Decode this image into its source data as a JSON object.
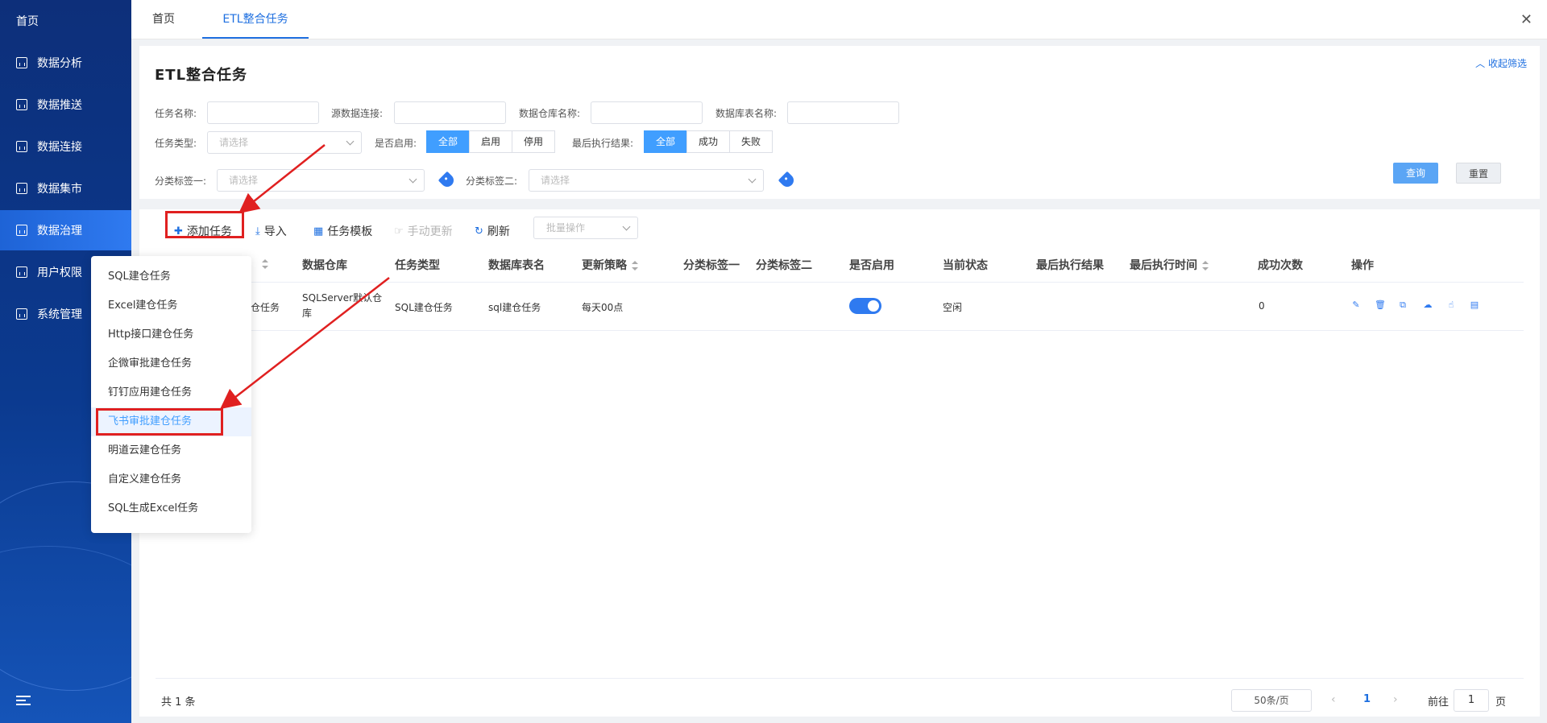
{
  "sidebar": {
    "home": "首页",
    "items": [
      {
        "label": "数据分析",
        "icon": "chart-icon"
      },
      {
        "label": "数据推送",
        "icon": "upload-chart-icon"
      },
      {
        "label": "数据连接",
        "icon": "connection-icon"
      },
      {
        "label": "数据集市",
        "icon": "monitor-icon"
      },
      {
        "label": "数据治理",
        "icon": "layers-icon",
        "active": true
      },
      {
        "label": "用户权限",
        "icon": "users-icon"
      },
      {
        "label": "系统管理",
        "icon": "system-icon"
      }
    ]
  },
  "tabs": {
    "home": "首页",
    "active": "ETL整合任务"
  },
  "filter": {
    "title": "ETL整合任务",
    "collapse": "收起筛选",
    "task_name_label": "任务名称:",
    "source_conn_label": "源数据连接:",
    "warehouse_name_label": "数据仓库名称:",
    "table_name_label": "数据库表名称:",
    "task_type_label": "任务类型:",
    "task_type_placeholder": "请选择",
    "enabled_label": "是否启用:",
    "enabled_options": [
      "全部",
      "启用",
      "停用"
    ],
    "last_result_label": "最后执行结果:",
    "last_result_options": [
      "全部",
      "成功",
      "失败"
    ],
    "tag1_label": "分类标签一:",
    "tag1_placeholder": "请选择",
    "tag2_label": "分类标签二:",
    "tag2_placeholder": "请选择",
    "query": "查询",
    "reset": "重置"
  },
  "toolbar": {
    "add": "添加任务",
    "import": "导入",
    "template": "任务模板",
    "manual_update": "手动更新",
    "refresh": "刷新",
    "batch_placeholder": "批量操作"
  },
  "table": {
    "headers": [
      "数据仓库",
      "任务类型",
      "数据库表名",
      "更新策略",
      "分类标签一",
      "分类标签二",
      "是否启用",
      "当前状态",
      "最后执行结果",
      "最后执行时间",
      "成功次数",
      "操作"
    ],
    "row": {
      "name_partial": "建仓任务",
      "warehouse": "SQLServer默认仓库",
      "task_type": "SQL建仓任务",
      "table_name": "sql建仓任务",
      "strategy": "每天00点",
      "tag1": "",
      "tag2": "",
      "enabled": true,
      "status": "空闲",
      "last_result": "",
      "last_time": "",
      "success_count": "0"
    }
  },
  "pager": {
    "total": "共 1 条",
    "page_size": "50条/页",
    "current": "1",
    "goto_prefix": "前往",
    "goto_value": "1",
    "goto_suffix": "页"
  },
  "dropdown": {
    "items": [
      "SQL建仓任务",
      "Excel建仓任务",
      "Http接口建仓任务",
      "企微审批建仓任务",
      "钉钉应用建仓任务",
      "飞书审批建仓任务",
      "明道云建仓任务",
      "自定义建仓任务",
      "SQL生成Excel任务"
    ],
    "highlighted_index": 5
  },
  "colors": {
    "primary": "#1e6fe0",
    "annotation": "#e02020",
    "sidebar": "#0b3a8f"
  }
}
